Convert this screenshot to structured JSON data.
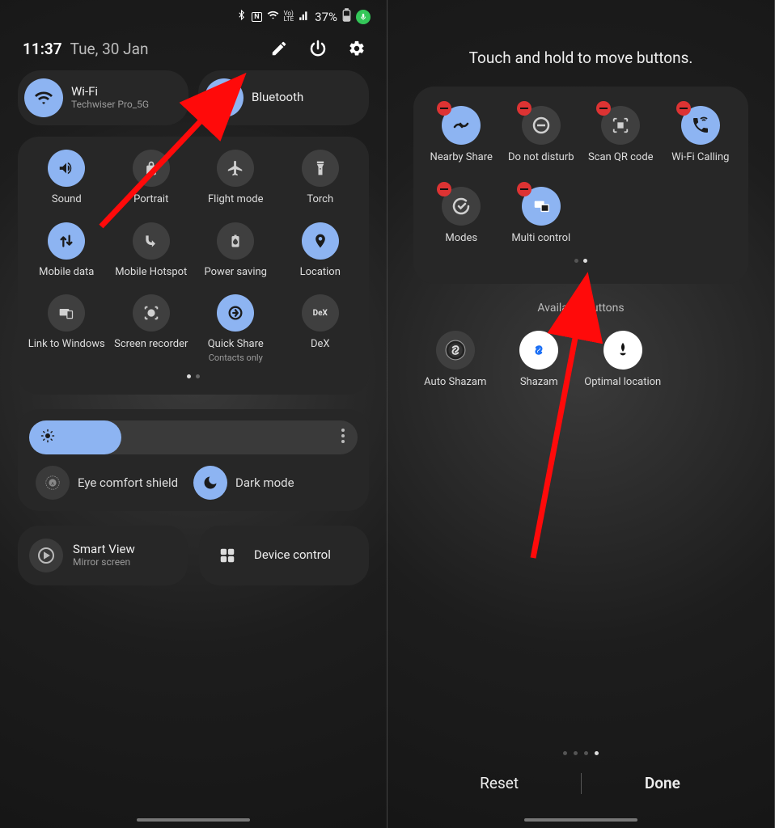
{
  "left": {
    "status": {
      "battery": "37%"
    },
    "header": {
      "time": "11:37",
      "date": "Tue, 30 Jan"
    },
    "pills": {
      "wifi": {
        "title": "Wi-Fi",
        "subtitle": "Techwiser Pro_5G"
      },
      "bt": {
        "title": "Bluetooth"
      }
    },
    "tiles": [
      {
        "label": "Sound"
      },
      {
        "label": "Portrait"
      },
      {
        "label": "Flight mode"
      },
      {
        "label": "Torch"
      },
      {
        "label": "Mobile data"
      },
      {
        "label": "Mobile Hotspot"
      },
      {
        "label": "Power saving"
      },
      {
        "label": "Location"
      },
      {
        "label": "Link to Windows"
      },
      {
        "label": "Screen recorder"
      },
      {
        "label": "Quick Share",
        "sub": "Contacts only"
      },
      {
        "label": "DeX"
      }
    ],
    "modes": {
      "eye": "Eye comfort shield",
      "dark": "Dark mode"
    },
    "bottom": {
      "smartview": {
        "title": "Smart View",
        "sub": "Mirror screen"
      },
      "devctrl": {
        "title": "Device control"
      }
    }
  },
  "right": {
    "title": "Touch and hold to move buttons.",
    "tiles": [
      {
        "label": "Nearby Share"
      },
      {
        "label": "Do not disturb"
      },
      {
        "label": "Scan QR code"
      },
      {
        "label": "Wi-Fi Calling"
      },
      {
        "label": "Modes"
      },
      {
        "label": "Multi control"
      }
    ],
    "available_title": "Available buttons",
    "available": [
      {
        "label": "Auto Shazam"
      },
      {
        "label": "Shazam"
      },
      {
        "label": "Optimal location"
      }
    ],
    "footer": {
      "reset": "Reset",
      "done": "Done"
    }
  }
}
